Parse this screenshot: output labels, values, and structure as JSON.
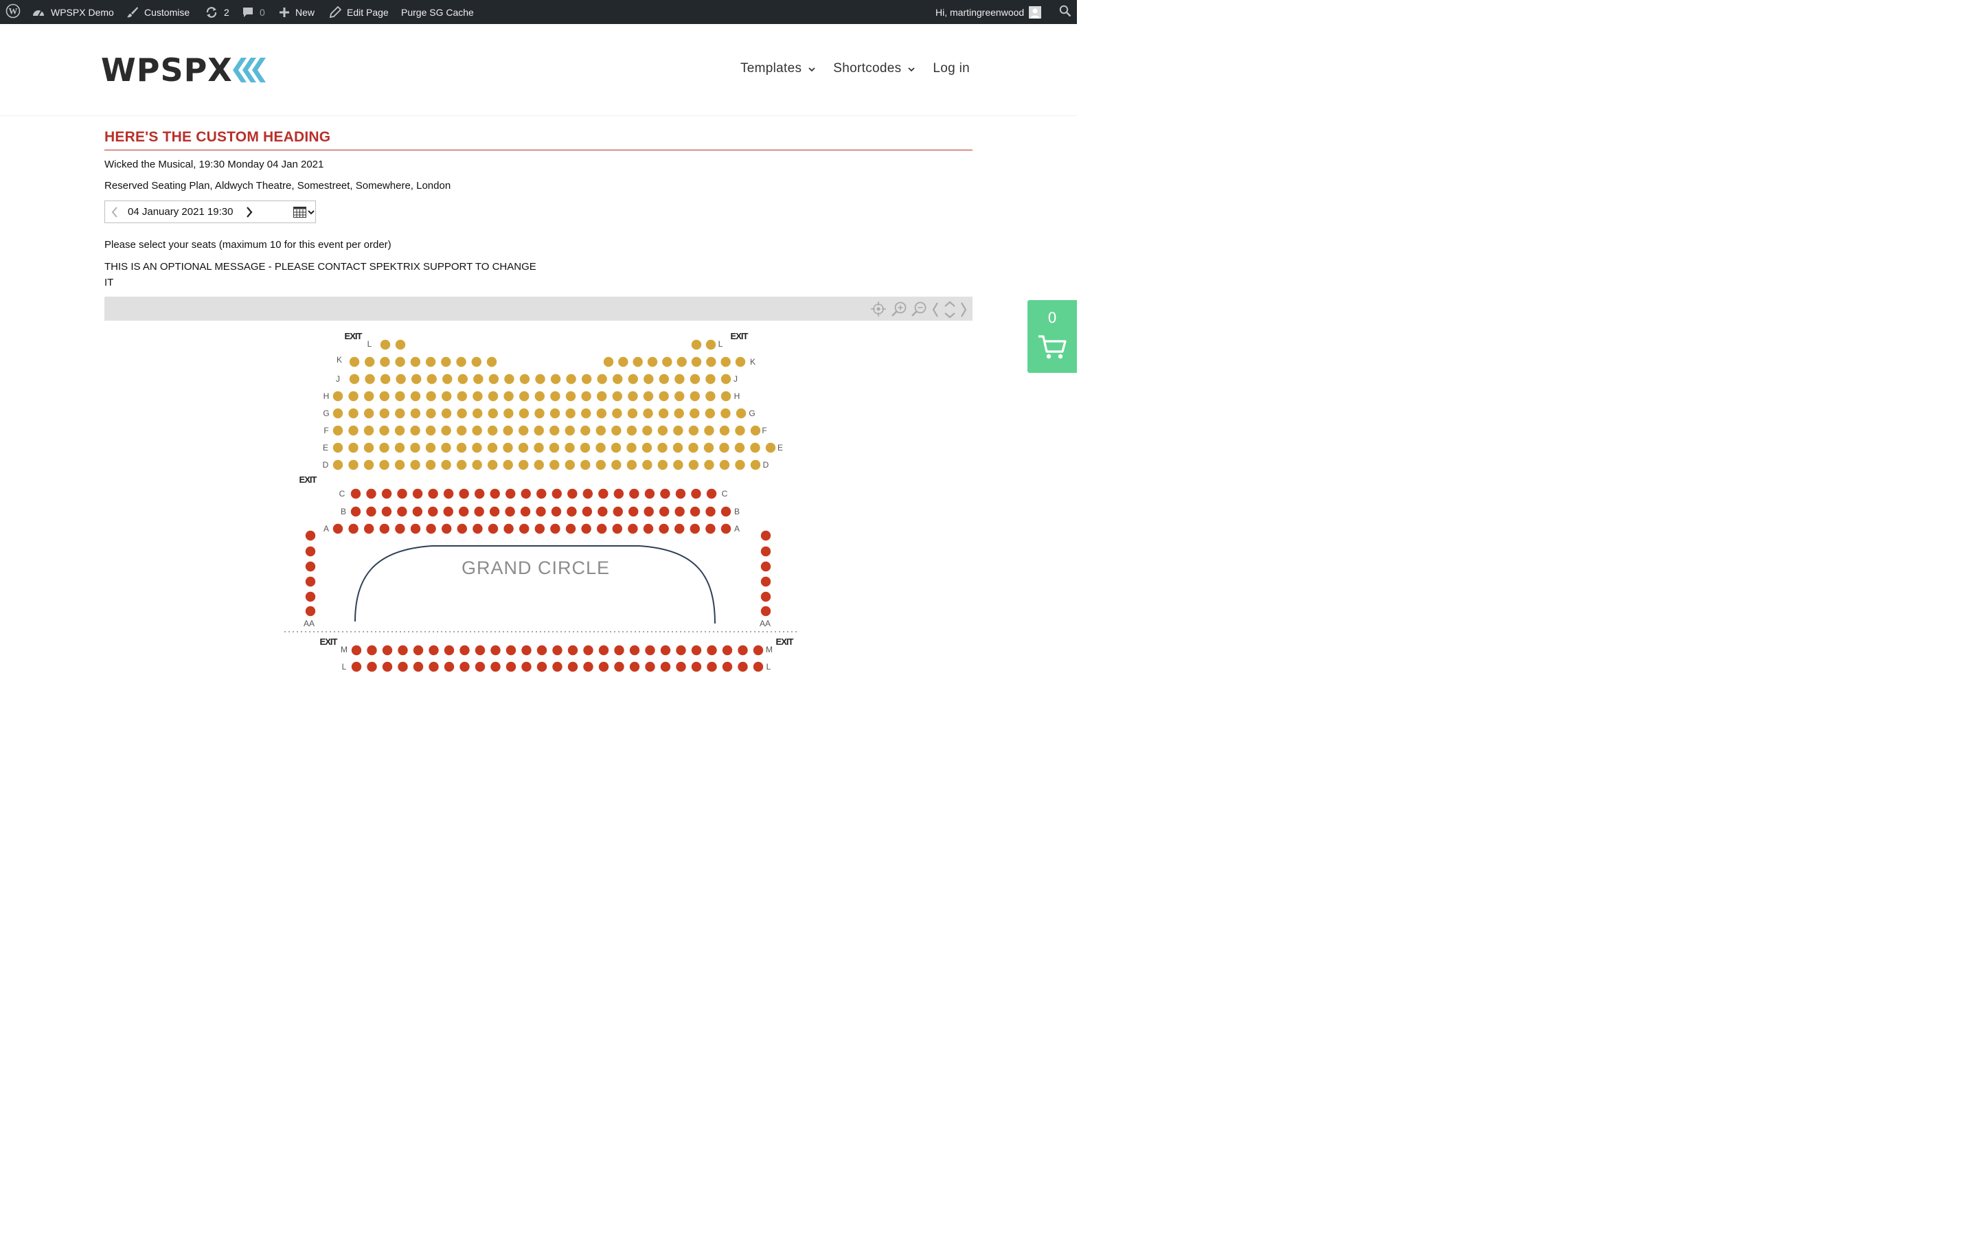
{
  "admin_bar": {
    "site_name": "WPSPX Demo",
    "customise": "Customise",
    "updates_count": "2",
    "comments_count": "0",
    "new_label": "New",
    "edit_page": "Edit Page",
    "purge_cache": "Purge SG Cache",
    "greeting": "Hi, martingreenwood"
  },
  "header": {
    "logo_text": "WPSPX",
    "nav": [
      {
        "label": "Templates",
        "has_dropdown": true
      },
      {
        "label": "Shortcodes",
        "has_dropdown": true
      },
      {
        "label": "Log in",
        "has_dropdown": false
      }
    ]
  },
  "content": {
    "heading": "HERE'S THE CUSTOM HEADING",
    "event_line": "Wicked the Musical, 19:30 Monday 04 Jan 2021",
    "venue_line": "Reserved Seating Plan, Aldwych Theatre, Somestreet, Somewhere, London",
    "date_value": "04 January 2021 19:30",
    "select_prompt": "Please select your seats (maximum 10 for this event per order)",
    "optional_message_1": "THIS IS AN OPTIONAL MESSAGE - PLEASE CONTACT SPEKTRIX SUPPORT TO CHANGE",
    "optional_message_2": "IT"
  },
  "seating": {
    "section_label": "GRAND CIRCLE",
    "exit_label": "EXIT",
    "row_labels": [
      "L",
      "K",
      "J",
      "H",
      "G",
      "F",
      "E",
      "D",
      "C",
      "B",
      "A",
      "AA",
      "M",
      "L"
    ],
    "colors": {
      "gold": "#d4a63a",
      "red": "#c9391f",
      "stage_line": "#2f3f56"
    }
  },
  "cart": {
    "count": "0"
  },
  "icons": [
    "wordpress-icon",
    "dashboard-icon",
    "brush-icon",
    "refresh-icon",
    "comment-icon",
    "plus-icon",
    "pencil-icon",
    "user-avatar",
    "search-icon",
    "chevron-down-icon",
    "chevron-left-icon",
    "chevron-right-icon",
    "calendar-icon",
    "recenter-icon",
    "zoom-in-icon",
    "zoom-out-icon",
    "collapse-icon",
    "cart-icon"
  ]
}
